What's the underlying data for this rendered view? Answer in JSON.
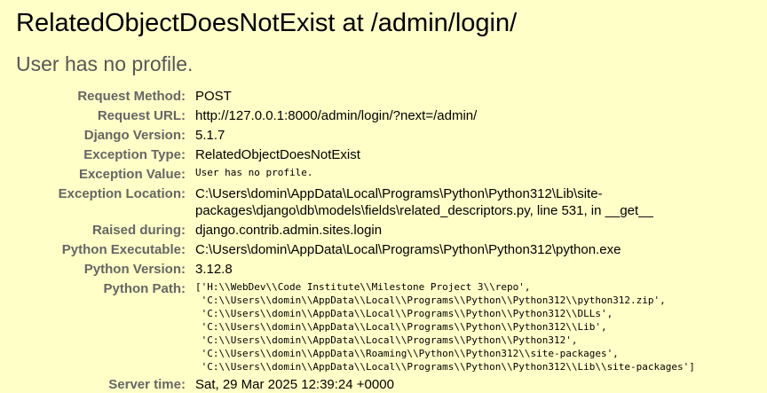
{
  "title": "RelatedObjectDoesNotExist at /admin/login/",
  "subtitle": "User has no profile.",
  "meta": {
    "request_method": {
      "label": "Request Method:",
      "value": "POST"
    },
    "request_url": {
      "label": "Request URL:",
      "value": "http://127.0.0.1:8000/admin/login/?next=/admin/"
    },
    "django_version": {
      "label": "Django Version:",
      "value": "5.1.7"
    },
    "exception_type": {
      "label": "Exception Type:",
      "value": "RelatedObjectDoesNotExist"
    },
    "exception_value": {
      "label": "Exception Value:",
      "value": "User has no profile."
    },
    "exception_location": {
      "label": "Exception Location:",
      "value": "C:\\Users\\domin\\AppData\\Local\\Programs\\Python\\Python312\\Lib\\site-packages\\django\\db\\models\\fields\\related_descriptors.py, line 531, in __get__"
    },
    "raised_during": {
      "label": "Raised during:",
      "value": "django.contrib.admin.sites.login"
    },
    "python_executable": {
      "label": "Python Executable:",
      "value": "C:\\Users\\domin\\AppData\\Local\\Programs\\Python\\Python312\\python.exe"
    },
    "python_version": {
      "label": "Python Version:",
      "value": "3.12.8"
    },
    "python_path": {
      "label": "Python Path:",
      "value": "['H:\\\\WebDev\\\\Code Institute\\\\Milestone Project 3\\\\repo',\n 'C:\\\\Users\\\\domin\\\\AppData\\\\Local\\\\Programs\\\\Python\\\\Python312\\\\python312.zip',\n 'C:\\\\Users\\\\domin\\\\AppData\\\\Local\\\\Programs\\\\Python\\\\Python312\\\\DLLs',\n 'C:\\\\Users\\\\domin\\\\AppData\\\\Local\\\\Programs\\\\Python\\\\Python312\\\\Lib',\n 'C:\\\\Users\\\\domin\\\\AppData\\\\Local\\\\Programs\\\\Python\\\\Python312',\n 'C:\\\\Users\\\\domin\\\\AppData\\\\Roaming\\\\Python\\\\Python312\\\\site-packages',\n 'C:\\\\Users\\\\domin\\\\AppData\\\\Local\\\\Programs\\\\Python\\\\Python312\\\\Lib\\\\site-packages']"
    },
    "server_time": {
      "label": "Server time:",
      "value": "Sat, 29 Mar 2025 12:39:24 +0000"
    }
  }
}
